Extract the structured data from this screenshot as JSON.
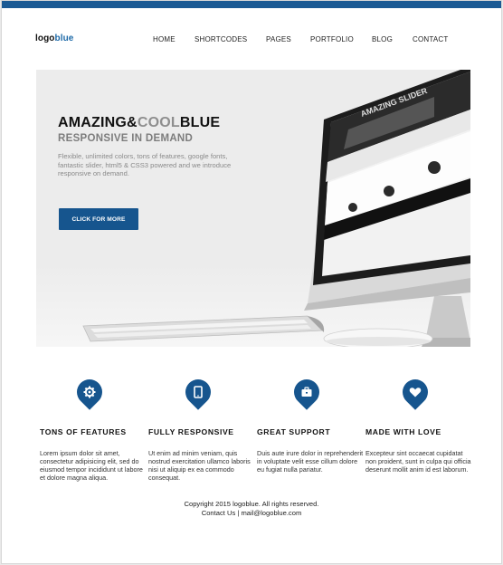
{
  "logo": {
    "part1": "logo",
    "part2": "blue"
  },
  "nav": [
    "HOME",
    "SHORTCODES",
    "PAGES",
    "PORTFOLIO",
    "BLOG",
    "CONTACT"
  ],
  "hero": {
    "title_a": "AMAZING&",
    "title_b": "COOL",
    "title_c": "BLUE",
    "subtitle": "RESPONSIVE IN DEMAND",
    "description": "Flexible, unlimited colors, tons of features, google fonts, fantastic slider, html5 & CSS3 powered and we introduce responsive on demand.",
    "button": "CLICK FOR MORE",
    "screen_text": "AMAZING SLIDER"
  },
  "features": [
    {
      "icon": "gear-icon",
      "title": "TONS OF FEATURES",
      "text": "Lorem ipsum dolor sit amet, consectetur adipisicing elit, sed do eiusmod tempor incididunt ut labore et dolore magna aliqua."
    },
    {
      "icon": "tablet-icon",
      "title": "FULLY RESPONSIVE",
      "text": "Ut enim ad minim veniam, quis nostrud exercitation ullamco laboris nisi ut aliquip ex ea commodo consequat."
    },
    {
      "icon": "briefcase-icon",
      "title": "GREAT SUPPORT",
      "text": "Duis aute irure dolor in reprehenderit in voluptate velit esse cillum dolore eu fugiat nulla pariatur."
    },
    {
      "icon": "heart-icon",
      "title": "MADE WITH LOVE",
      "text": "Excepteur sint occaecat cupidatat non proident, sunt in culpa qui officia deserunt mollit anim id est laborum."
    }
  ],
  "footer": {
    "copyright": "Copyright 2015 logoblue. All rights reserved.",
    "contact": "Contact Us | mail@logoblue.com"
  },
  "colors": {
    "accent": "#16558e",
    "topbar": "#1b5a94"
  }
}
